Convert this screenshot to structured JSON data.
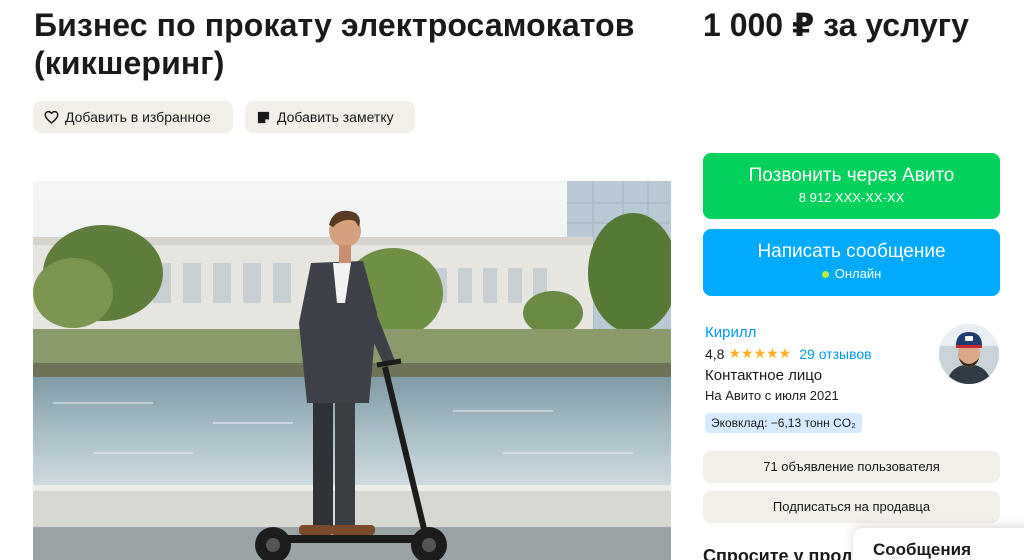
{
  "listing": {
    "title": "Бизнес по прокату электросамокатов (кикшеринг)",
    "price": "1 000 ₽ за услугу"
  },
  "actions": {
    "favorite_label": "Добавить в избранное",
    "note_label": "Добавить заметку"
  },
  "contact": {
    "call_label": "Позвонить через Авито",
    "call_phone": "8 912 XXX-XX-XX",
    "message_label": "Написать сообщение",
    "online_status": "Онлайн"
  },
  "seller": {
    "name": "Кирилл",
    "rating": "4,8",
    "stars": "★★★★★",
    "reviews": "29 отзывов",
    "role": "Контактное лицо",
    "since": "На Авито с июля 2021",
    "eco": "Эковклад: −6,13 тонн CO₂",
    "ads_label": "71 объявление пользователя",
    "subscribe_label": "Подписаться на продавца"
  },
  "footer": {
    "ask_heading": "Спросите у продавца",
    "messages_label": "Сообщения"
  },
  "colors": {
    "call_button": "#02d15c",
    "message_button": "#00aaff",
    "link": "#0099f7",
    "star": "#ffb021",
    "chip_bg": "#f2eee8"
  },
  "icons": {
    "favorite": "heart-icon",
    "note": "note-icon"
  }
}
